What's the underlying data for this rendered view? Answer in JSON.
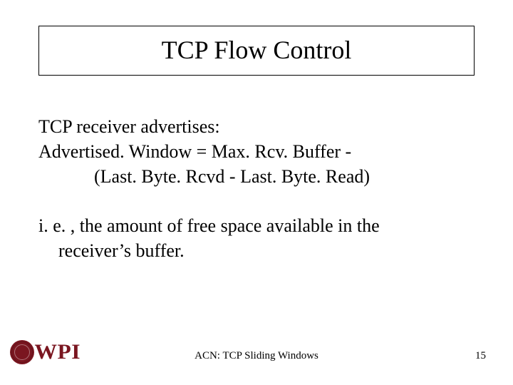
{
  "title": "TCP Flow Control",
  "body": {
    "line1": "TCP receiver advertises:",
    "line2": "Advertised. Window = Max. Rcv. Buffer -",
    "line3": "(Last. Byte. Rcvd  - Last. Byte. Read)",
    "line4": "i. e. , the amount of free space available in the",
    "line5": "receiver’s buffer."
  },
  "footer": {
    "logo_text": "WPI",
    "center": "ACN: TCP Sliding Windows",
    "page_num": "15"
  }
}
